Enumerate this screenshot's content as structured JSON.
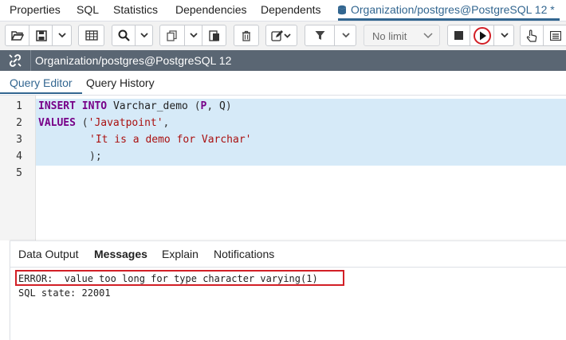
{
  "top_tabs": {
    "properties": "Properties",
    "sql": "SQL",
    "statistics": "Statistics",
    "dependencies": "Dependencies",
    "dependents": "Dependents",
    "query_tool": "Organization/postgres@PostgreSQL 12 *"
  },
  "toolbar": {
    "limit_value": "No limit"
  },
  "connection": {
    "title": "Organization/postgres@PostgreSQL 12"
  },
  "editor_tabs": {
    "query_editor": "Query Editor",
    "query_history": "Query History"
  },
  "editor": {
    "line_numbers": [
      "1",
      "2",
      "3",
      "4",
      "5"
    ],
    "line1": {
      "kw1": "INSERT",
      "kw2": "INTO",
      "table": "Varchar_demo",
      "open": "(",
      "col1": "P",
      "comma": ",",
      "col2": "Q",
      "close": ")"
    },
    "line2": {
      "kw": "VALUES",
      "open": "(",
      "str": "'Javatpoint'",
      "comma": ","
    },
    "line3": {
      "str": "'It is a demo for Varchar'"
    },
    "line4": {
      "close": ");"
    }
  },
  "results": {
    "tabs": {
      "data_output": "Data Output",
      "messages": "Messages",
      "explain": "Explain",
      "notifications": "Notifications"
    },
    "error_line": "ERROR:  value too long for type character varying(1)",
    "state_line": "SQL state: 22001"
  },
  "colors": {
    "accent": "#326690",
    "header_bar": "#5a6673",
    "keyword": "#770088",
    "string": "#aa1111",
    "error_outline": "#d21f26",
    "selection": "#d6eaf8"
  }
}
